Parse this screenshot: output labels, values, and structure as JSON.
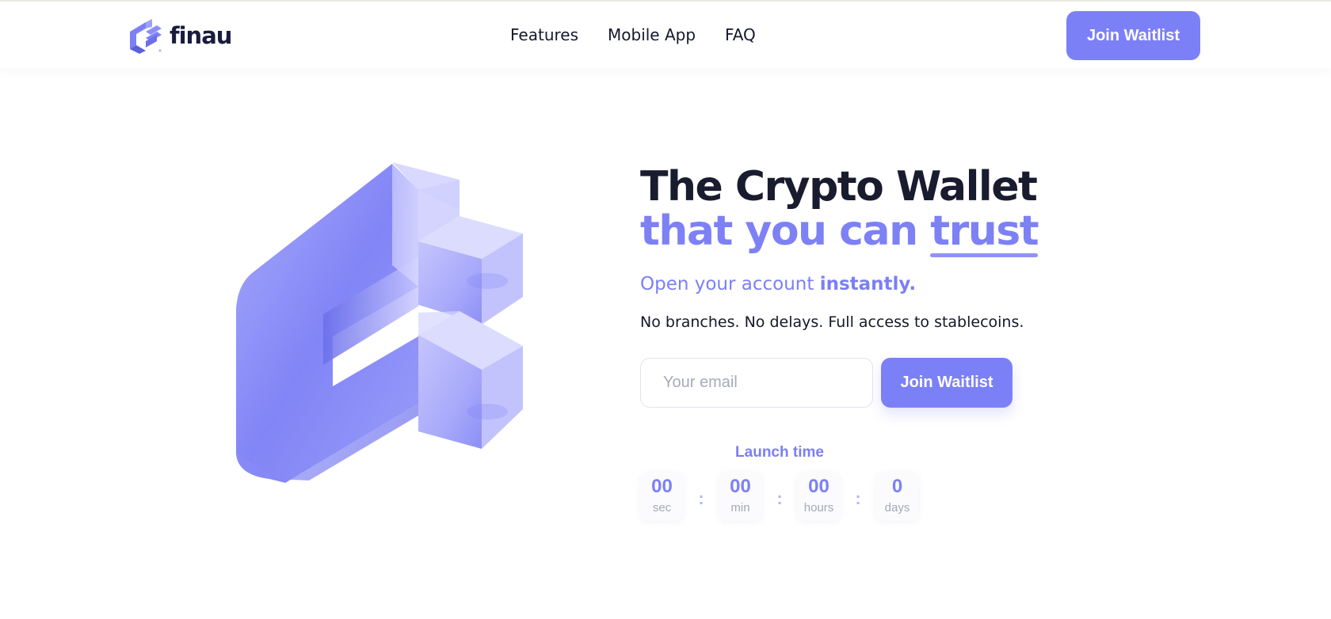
{
  "brand": {
    "name": "finau",
    "accent_color": "#7c80f7",
    "dark_color": "#191b2e"
  },
  "header": {
    "nav": [
      {
        "label": "Features"
      },
      {
        "label": "Mobile App"
      },
      {
        "label": "FAQ"
      }
    ],
    "cta_label": "Join Waitlist"
  },
  "hero": {
    "title_line1": "The Crypto Wallet",
    "title_line2_prefix": "that you can ",
    "title_line2_emphasis": "trust",
    "subtitle_prefix": "Open your account ",
    "subtitle_emphasis": "instantly.",
    "description": "No branches. No delays. Full access to stablecoins.",
    "email_placeholder": "Your email",
    "email_value": "",
    "cta_label": "Join Waitlist",
    "visual_icon": "finau-3d-logo-icon"
  },
  "launch": {
    "label": "Launch time",
    "units": [
      {
        "value": "00",
        "unit": "sec"
      },
      {
        "value": "00",
        "unit": "min"
      },
      {
        "value": "00",
        "unit": "hours"
      },
      {
        "value": "0",
        "unit": "days"
      }
    ],
    "separator": ":"
  }
}
